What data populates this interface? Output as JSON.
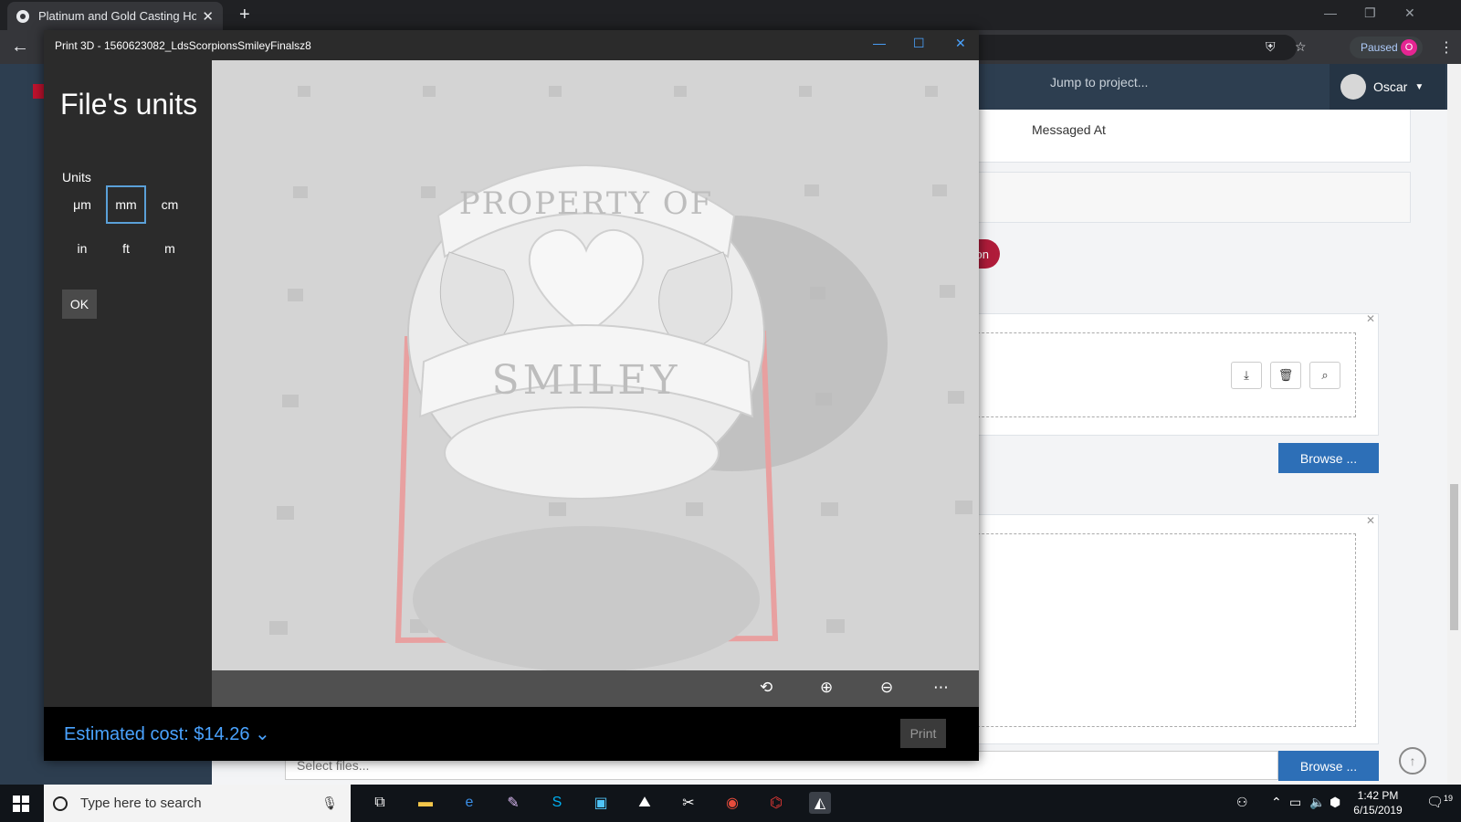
{
  "browser": {
    "tab_title": "Platinum and Gold Casting House",
    "tab_close": "✕",
    "new_tab": "+",
    "back": "←",
    "paused_label": "Paused",
    "profile_initial": "O",
    "menu": "⋮"
  },
  "webpage": {
    "jump_placeholder": "Jump to project...",
    "user_name": "Oscar",
    "messaged_at": "Messaged At",
    "red_pill_text": "on",
    "browse_label": "Browse ...",
    "select_files_placeholder": "Select files...",
    "accent_blue": "#2d6fb7",
    "accent_red": "#b01c3a"
  },
  "print3d": {
    "window_title": "Print 3D - 1560623082_LdsScorpionsSmileyFinalsz8",
    "heading": "File's units",
    "units_label": "Units",
    "units": [
      "μm",
      "mm",
      "cm",
      "in",
      "ft",
      "m"
    ],
    "selected_unit": "mm",
    "ok_label": "OK",
    "estimated_cost": "Estimated cost: $14.26",
    "print_label": "Print",
    "model_text_top": "PROPERTY OF",
    "model_text_banner": "SMILEY",
    "toolbar_icons": [
      "3d-view-icon",
      "zoom-in-icon",
      "zoom-out-icon",
      "more-icon"
    ]
  },
  "taskbar": {
    "search_placeholder": "Type here to search",
    "time": "1:42 PM",
    "date": "6/15/2019",
    "notification_count": "19"
  }
}
